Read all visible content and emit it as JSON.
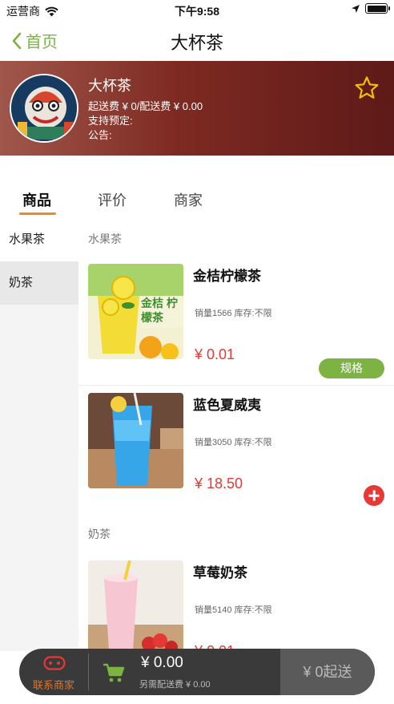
{
  "status_bar": {
    "carrier": "运营商",
    "time": "下午9:58"
  },
  "nav": {
    "back_label": "首页",
    "title": "大杯茶"
  },
  "shop": {
    "name": "大杯茶",
    "fees": "起送费 ¥ 0/配送费 ¥ 0.00",
    "reservation": "支持预定:",
    "notice": "公告:"
  },
  "tabs": [
    {
      "label": "商品",
      "active": true
    },
    {
      "label": "评价",
      "active": false
    },
    {
      "label": "商家",
      "active": false
    }
  ],
  "categories": [
    {
      "label": "水果茶",
      "selected": false
    },
    {
      "label": "奶茶",
      "selected": true
    }
  ],
  "sections": [
    {
      "title": "水果茶",
      "products": [
        {
          "name": "金桔柠檬茶",
          "meta": "销量1566 库存:不限",
          "price": "¥ 0.01",
          "action": "规格",
          "image_text": "金桔 柠檬茶"
        },
        {
          "name": "蓝色夏威夷",
          "meta": "销量3050 库存:不限",
          "price": "¥ 18.50",
          "action": "add"
        }
      ]
    },
    {
      "title": "奶茶",
      "products": [
        {
          "name": "草莓奶茶",
          "meta": "销量5140 库存:不限",
          "price": "¥ 0.01"
        }
      ]
    }
  ],
  "cart": {
    "contact_label": "联系商家",
    "total": "¥ 0.00",
    "delivery": "另需配送费 ¥ 0.00",
    "checkout_label": "¥ 0起送"
  },
  "colors": {
    "accent_green": "#7cb342",
    "price_red": "#e53935",
    "tab_underline": "#ef8a22",
    "contact_orange": "#e57322"
  }
}
